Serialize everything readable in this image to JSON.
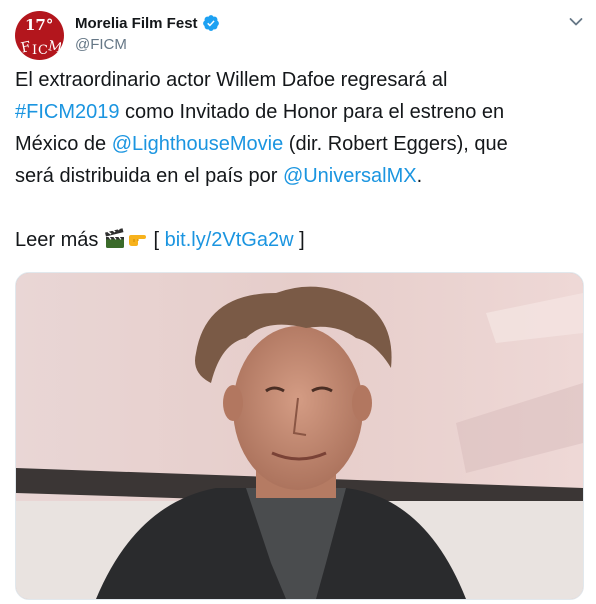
{
  "tweet": {
    "author": {
      "display_name": "Morelia Film Fest",
      "handle": "@FICM",
      "verified_icon": "verified-badge-icon",
      "avatar_text": "17°"
    },
    "menu_icon": "chevron-down-icon",
    "text": {
      "line1": "El extraordinario actor Willem Dafoe regresará al",
      "hashtag": "#FICM2019",
      "line2_rest": " como Invitado de Honor para el estreno en",
      "line3_start": "México de ",
      "mention1": "@LighthouseMovie",
      "line3_rest": " (dir. Robert Eggers), que",
      "line4_start": "será distribuida en el país por ",
      "mention2": "@UniversalMX",
      "line4_end": ".",
      "read_more": "Leer más ",
      "bracket_open": " [ ",
      "short_link": "bit.ly/2VtGa2w",
      "bracket_close": " ]"
    },
    "emojis": [
      "clapper-board-icon",
      "pointing-right-icon"
    ],
    "colors": {
      "link": "#1b95e0",
      "avatar_red": "#b3161d",
      "verified_blue": "#1da1f2",
      "handle_gray": "#657786"
    }
  }
}
